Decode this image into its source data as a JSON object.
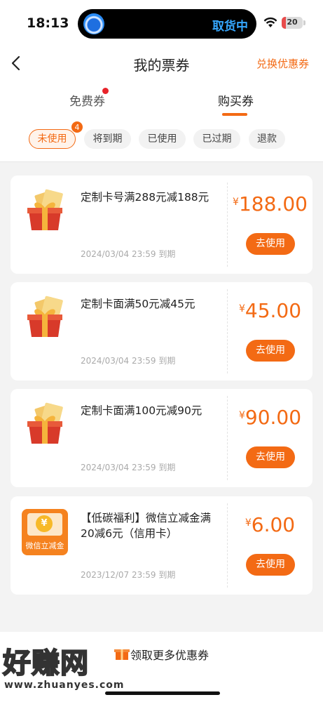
{
  "status_bar": {
    "time": "18:13",
    "live_activity_text": "取货中",
    "battery_level": "20",
    "battery_fraction": 0.2,
    "icons": [
      "wifi-icon",
      "battery-icon"
    ]
  },
  "nav": {
    "title": "我的票券",
    "right_link": "兑换优惠券",
    "back_icon": "chevron-left-icon"
  },
  "tabs": [
    {
      "label": "免费券",
      "has_dot": true
    },
    {
      "label": "购买券",
      "active": true
    }
  ],
  "filters": [
    {
      "label": "未使用",
      "active": true,
      "badge": "4"
    },
    {
      "label": "将到期"
    },
    {
      "label": "已使用"
    },
    {
      "label": "已过期"
    },
    {
      "label": "退款"
    }
  ],
  "coupons": [
    {
      "title": "定制卡号满288元减188元",
      "expiry": "2024/03/04 23:59 到期",
      "currency": "¥",
      "amount": "188.00",
      "action": "去使用",
      "image": "gift-box-icon"
    },
    {
      "title": "定制卡面满50元减45元",
      "expiry": "2024/03/04 23:59 到期",
      "currency": "¥",
      "amount": "45.00",
      "action": "去使用",
      "image": "gift-box-icon"
    },
    {
      "title": "定制卡面满100元减90元",
      "expiry": "2024/03/04 23:59 到期",
      "currency": "¥",
      "amount": "90.00",
      "action": "去使用",
      "image": "gift-box-icon"
    },
    {
      "title": "【低碳福利】微信立减金满20减6元（信用卡）",
      "expiry": "2023/12/07 23:59 到期",
      "currency": "¥",
      "amount": "6.00",
      "action": "去使用",
      "image": "wechat-coupon-icon",
      "image_label": "微信立减金"
    }
  ],
  "bottom": {
    "more_link": "领取更多优惠券",
    "watermark": "好赚网",
    "watermark_url": "www.zhuanyes.com"
  },
  "colors": {
    "accent": "#f36a14",
    "background": "#f3f3f3",
    "island_text": "#35a7ff"
  }
}
